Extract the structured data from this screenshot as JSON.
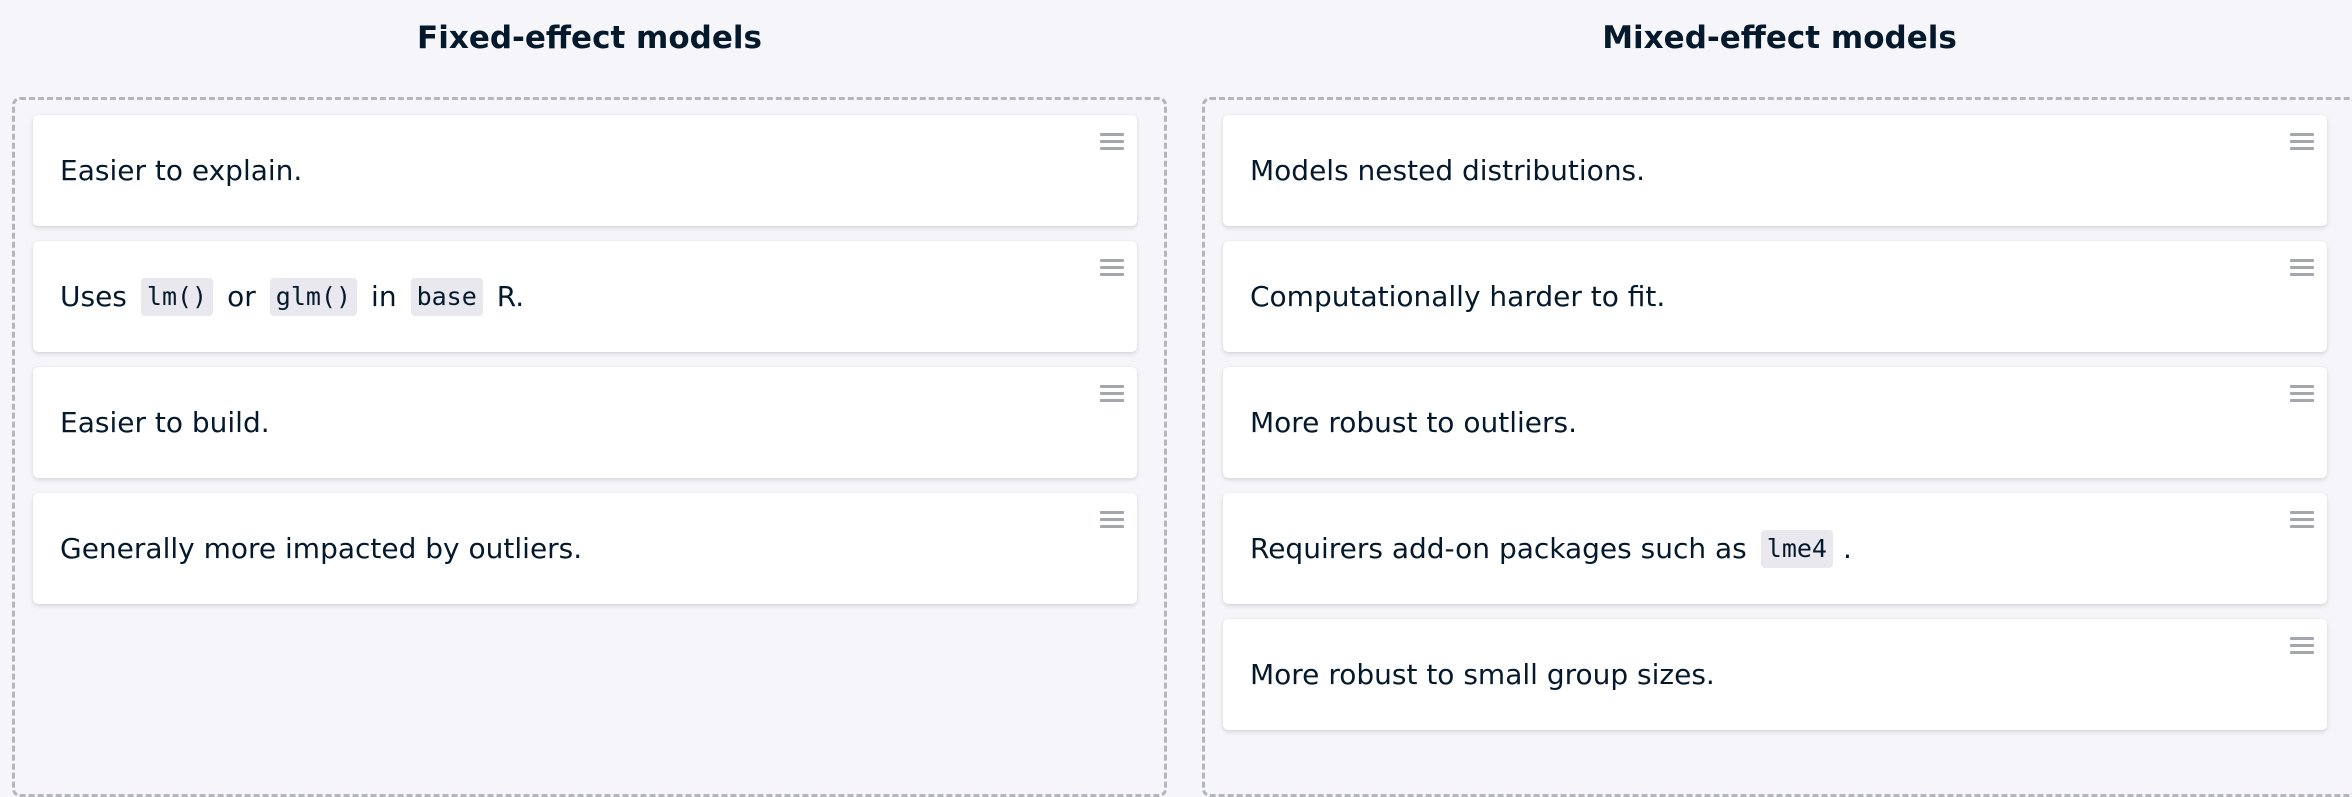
{
  "columns": [
    {
      "title": "Fixed-effect models",
      "cards": [
        {
          "parts": [
            {
              "t": "Easier to explain."
            }
          ]
        },
        {
          "parts": [
            {
              "t": "Uses"
            },
            {
              "c": "lm()"
            },
            {
              "t": "or"
            },
            {
              "c": "glm()"
            },
            {
              "t": "in"
            },
            {
              "c": "base"
            },
            {
              "t": "R."
            }
          ]
        },
        {
          "parts": [
            {
              "t": "Easier to build."
            }
          ]
        },
        {
          "parts": [
            {
              "t": "Generally more impacted by outliers."
            }
          ]
        }
      ]
    },
    {
      "title": "Mixed-effect models",
      "cards": [
        {
          "parts": [
            {
              "t": "Models nested distributions."
            }
          ]
        },
        {
          "parts": [
            {
              "t": "Computationally harder to fit."
            }
          ]
        },
        {
          "parts": [
            {
              "t": "More robust to outliers."
            }
          ]
        },
        {
          "parts": [
            {
              "t": "Requirers add-on packages such as"
            },
            {
              "c": "lme4"
            },
            {
              "t": "."
            }
          ]
        },
        {
          "parts": [
            {
              "t": "More robust to small group sizes."
            }
          ]
        }
      ]
    }
  ],
  "icons": {
    "drag_handle": "drag-handle-icon"
  }
}
